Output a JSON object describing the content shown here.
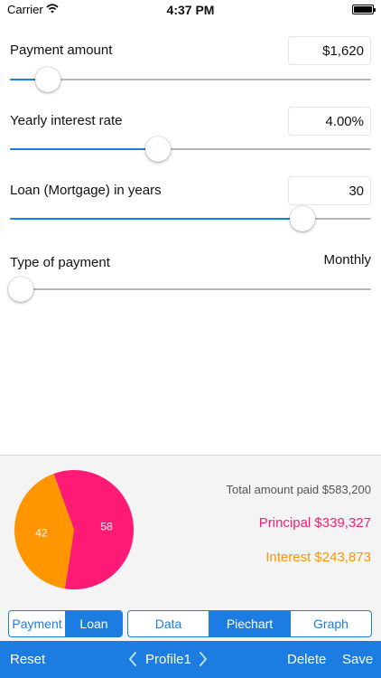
{
  "status_bar": {
    "carrier": "Carrier",
    "time": "4:37 PM",
    "battery_level": 1.0
  },
  "inputs": {
    "payment_amount": {
      "label": "Payment amount",
      "value": "$1,620",
      "slider_level": 0.105
    },
    "interest_rate": {
      "label": "Yearly interest rate",
      "value": "4.00%",
      "slider_level": 0.41
    },
    "loan_years": {
      "label": "Loan (Mortgage) in years",
      "value": "30",
      "slider_level": 0.81
    },
    "payment_type": {
      "label": "Type of payment",
      "value": "Monthly",
      "slider_level": 0.03
    }
  },
  "results": {
    "total": "Total amount paid $583,200",
    "principal": "Principal $339,327",
    "interest": "Interest $243,873"
  },
  "chart_data": {
    "type": "pie",
    "slices": [
      {
        "label": "58",
        "value": 58,
        "color": "#ff1a75"
      },
      {
        "label": "42",
        "value": 42,
        "color": "#ff9500"
      }
    ]
  },
  "colors": {
    "accent": "#1d7ce0",
    "principal": "#ff1a75",
    "interest": "#ff9500"
  },
  "segments": {
    "mode": [
      {
        "label": "Payment",
        "active": false
      },
      {
        "label": "Loan",
        "active": true
      }
    ],
    "view": [
      {
        "label": "Data",
        "active": false
      },
      {
        "label": "Piechart",
        "active": true
      },
      {
        "label": "Graph",
        "active": false
      }
    ]
  },
  "toolbar": {
    "reset": "Reset",
    "profile": "Profile1",
    "delete": "Delete",
    "save": "Save",
    "prev_icon": "chevron-left-icon",
    "next_icon": "chevron-right-icon"
  }
}
